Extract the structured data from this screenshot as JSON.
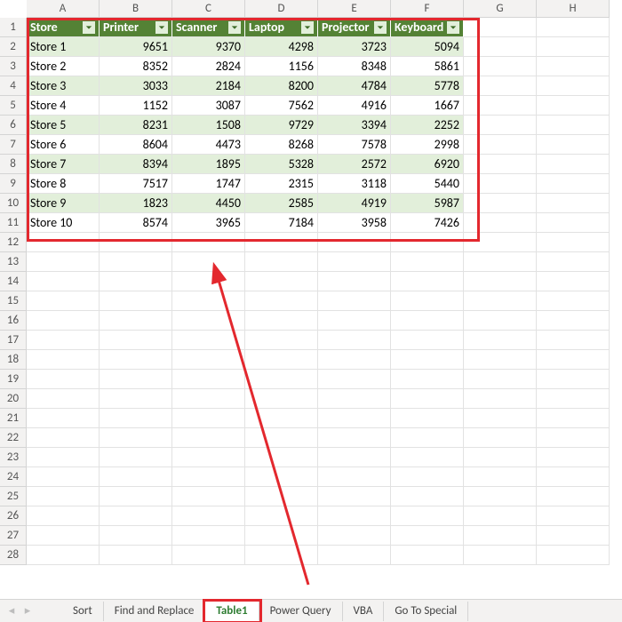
{
  "columns": [
    "A",
    "B",
    "C",
    "D",
    "E",
    "F",
    "G",
    "H"
  ],
  "row_count": 28,
  "table": {
    "headers": [
      "Store",
      "Printer",
      "Scanner",
      "Laptop",
      "Projector",
      "Keyboard"
    ],
    "rows": [
      {
        "store": "Store 1",
        "vals": [
          9651,
          9370,
          4298,
          3723,
          5094
        ]
      },
      {
        "store": "Store 2",
        "vals": [
          8352,
          2824,
          1156,
          8348,
          5861
        ]
      },
      {
        "store": "Store 3",
        "vals": [
          3033,
          2184,
          8200,
          4784,
          5778
        ]
      },
      {
        "store": "Store 4",
        "vals": [
          1152,
          3087,
          7562,
          4916,
          1667
        ]
      },
      {
        "store": "Store 5",
        "vals": [
          8231,
          1508,
          9729,
          3394,
          2252
        ]
      },
      {
        "store": "Store 6",
        "vals": [
          8604,
          4473,
          8268,
          7578,
          2998
        ]
      },
      {
        "store": "Store 7",
        "vals": [
          8394,
          1895,
          5328,
          2572,
          6920
        ]
      },
      {
        "store": "Store 8",
        "vals": [
          7517,
          1747,
          2315,
          3118,
          5440
        ]
      },
      {
        "store": "Store 9",
        "vals": [
          1823,
          4450,
          2585,
          4919,
          5987
        ]
      },
      {
        "store": "Store 10",
        "vals": [
          8574,
          3965,
          7184,
          3958,
          7426
        ]
      }
    ]
  },
  "tabs": {
    "items": [
      "Sort",
      "Find and Replace",
      "Table1",
      "Power Query",
      "VBA",
      "Go To Special"
    ],
    "active": "Table1"
  },
  "chart_data": {
    "type": "table",
    "columns": [
      "Store",
      "Printer",
      "Scanner",
      "Laptop",
      "Projector",
      "Keyboard"
    ],
    "rows": [
      [
        "Store 1",
        9651,
        9370,
        4298,
        3723,
        5094
      ],
      [
        "Store 2",
        8352,
        2824,
        1156,
        8348,
        5861
      ],
      [
        "Store 3",
        3033,
        2184,
        8200,
        4784,
        5778
      ],
      [
        "Store 4",
        1152,
        3087,
        7562,
        4916,
        1667
      ],
      [
        "Store 5",
        8231,
        1508,
        9729,
        3394,
        2252
      ],
      [
        "Store 6",
        8604,
        4473,
        8268,
        7578,
        2998
      ],
      [
        "Store 7",
        8394,
        1895,
        5328,
        2572,
        6920
      ],
      [
        "Store 8",
        7517,
        1747,
        2315,
        3118,
        5440
      ],
      [
        "Store 9",
        1823,
        4450,
        2585,
        4919,
        5987
      ],
      [
        "Store 10",
        8574,
        3965,
        7184,
        3958,
        7426
      ]
    ]
  }
}
